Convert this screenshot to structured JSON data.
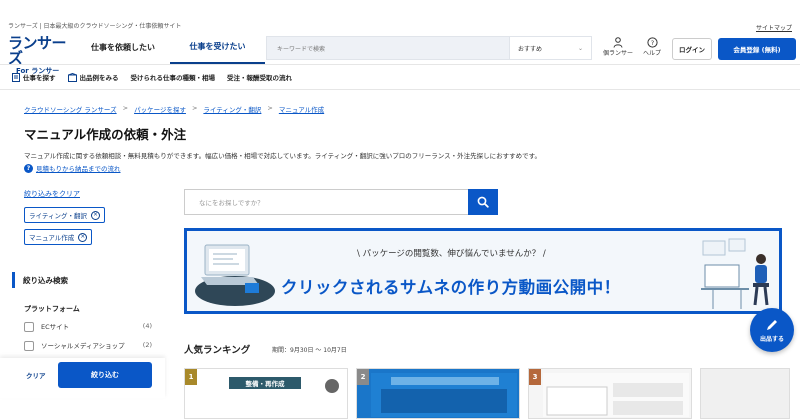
{
  "top": {
    "tagline": "ランサーズ | 日本最大級のクラウドソーシング・仕事依頼サイト",
    "sitemap": "サイトマップ"
  },
  "header": {
    "logo_main": "ランサーズ",
    "logo_sub": "For ランサー",
    "tabs": [
      "仕事を依頼したい",
      "仕事を受けたい"
    ],
    "search_placeholder": "キーワードで検索",
    "sort_value": "おすすめ",
    "person_label": "個ランサー",
    "help_label": "ヘルプ",
    "login": "ログイン",
    "signup": "会員登録 (無料)"
  },
  "subnav": [
    "仕事を探す",
    "出品例をみる",
    "受けられる仕事の種類・相場",
    "受注・報酬受取の流れ"
  ],
  "breadcrumb": [
    "クラウドソーシング ランサーズ",
    "パッケージを探す",
    "ライティング・翻訳",
    "マニュアル作成"
  ],
  "page": {
    "title": "マニュアル作成の依頼・外注",
    "description": "マニュアル作成に関する依頼相談・無料見積もりができます。幅広い価格・相場で対応しています。ライティング・翻訳に強いプロのフリーランス・外注先探しにおすすめです。",
    "flow_link": "見積もりから納品までの流れ"
  },
  "filters": {
    "clear": "絞り込みをクリア",
    "chips": [
      "ライティング・翻訳",
      "マニュアル作成"
    ],
    "section_title": "絞り込み検索",
    "platform_heading": "プラットフォーム",
    "options": [
      {
        "label": "ECサイト",
        "count": "(4)"
      },
      {
        "label": "ソーシャルメディアショップ",
        "count": "(2)"
      }
    ],
    "footer_clear": "クリア",
    "footer_apply": "絞り込む"
  },
  "main_search": {
    "placeholder": "なにをお探しですか？"
  },
  "banner": {
    "top_line": "パッケージの閲覧数、伸び悩んでいませんか？",
    "headline": "クリックされるサムネの作り方動画公開中！"
  },
  "ranking": {
    "title": "人気ランキング",
    "period": "期間：9月30日 〜 10月7日",
    "cards": [
      {
        "rank": "1",
        "label": "整備・再作成"
      },
      {
        "rank": "2",
        "label": ""
      },
      {
        "rank": "3",
        "label": ""
      }
    ]
  },
  "fab": {
    "label": "出品する"
  },
  "colors": {
    "brand_blue": "#0a57c7",
    "brand_navy": "#0a3f8c"
  }
}
